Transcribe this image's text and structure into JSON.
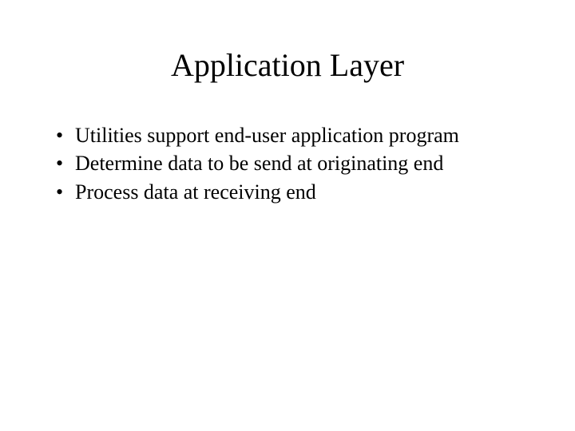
{
  "slide": {
    "title": "Application Layer",
    "bullets": [
      "Utilities support end-user application program",
      "Determine data to be send at originating end",
      "Process data at receiving end"
    ]
  }
}
